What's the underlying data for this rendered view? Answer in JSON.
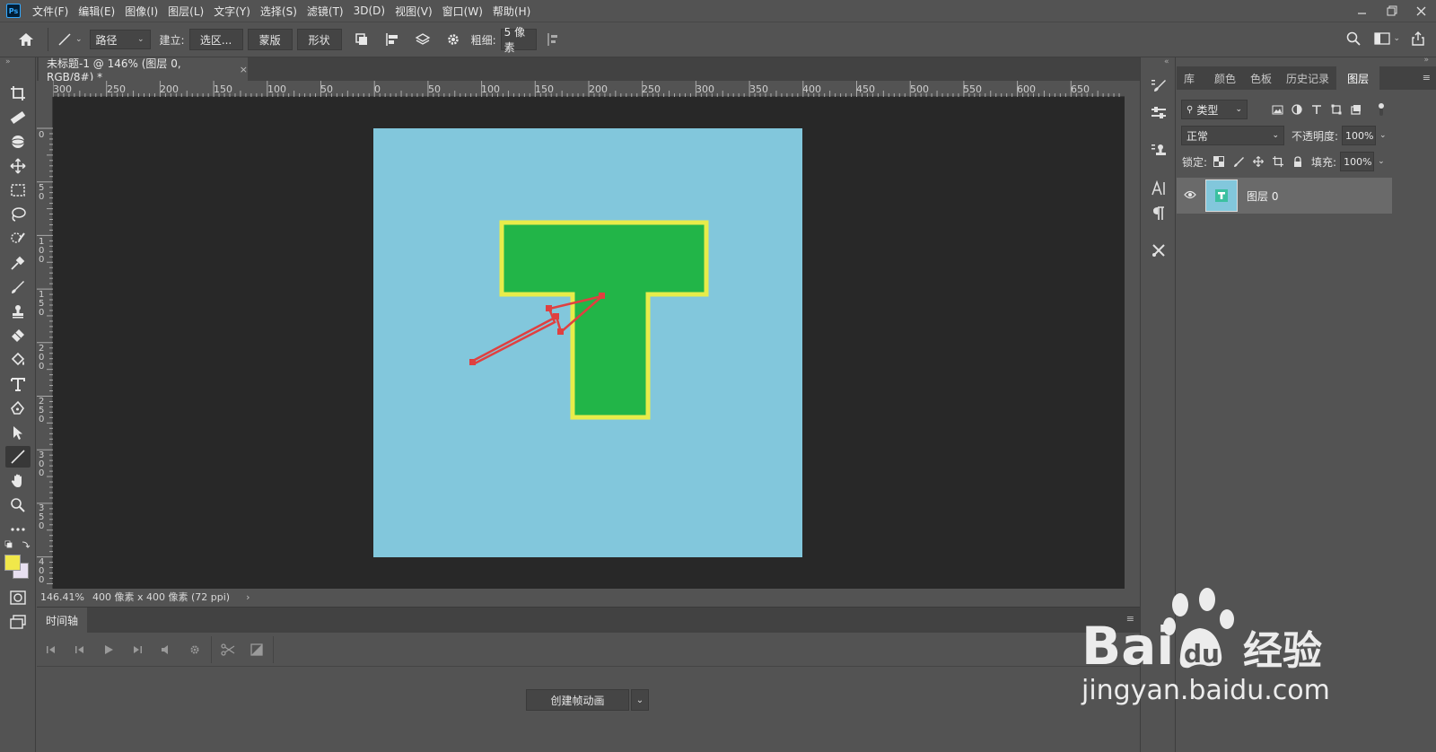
{
  "app": {
    "logo": "Ps",
    "menu": [
      "文件(F)",
      "编辑(E)",
      "图像(I)",
      "图层(L)",
      "文字(Y)",
      "选择(S)",
      "滤镜(T)",
      "3D(D)",
      "视图(V)",
      "窗口(W)",
      "帮助(H)"
    ]
  },
  "options": {
    "mode": "路径",
    "make_label": "建立:",
    "selection_btn": "选区...",
    "mask_btn": "蒙版",
    "shape_btn": "形状",
    "weight_label": "粗细:",
    "weight_value": "5 像素"
  },
  "document": {
    "tab_title": "未标题-1 @ 146% (图层 0, RGB/8#) *",
    "close": "×",
    "zoom": "146.41%",
    "info": "400 像素 x 400 像素 (72 ppi)",
    "canvas_color": "#82c7dc"
  },
  "ruler": {
    "h_labels": [
      "300",
      "250",
      "200",
      "150",
      "100",
      "50",
      "0",
      "50",
      "100",
      "150",
      "200",
      "250",
      "300",
      "350",
      "400",
      "450",
      "500",
      "550",
      "600",
      "650"
    ],
    "v_labels": [
      "0",
      "5 0",
      "1 0 0",
      "1 5 0",
      "2 0 0",
      "2 5 0",
      "3 0 0",
      "3 5 0",
      "4 0 0"
    ]
  },
  "artwork": {
    "t_fill": "#22b548",
    "t_stroke": "#e8ec4a",
    "arrow_color": "#e04040"
  },
  "timeline": {
    "tab": "时间轴",
    "create_btn": "创建帧动画"
  },
  "panels": {
    "tabs": [
      "库",
      "颜色",
      "色板",
      "历史记录",
      "图层"
    ],
    "filter": "类型",
    "blend_mode": "正常",
    "opacity_label": "不透明度:",
    "opacity_value": "100%",
    "lock_label": "锁定:",
    "fill_label": "填充:",
    "fill_value": "100%",
    "layer_name": "图层 0"
  },
  "colors": {
    "foreground": "#f0e84a",
    "background": "#e8e0f0"
  },
  "watermark": {
    "brand": "Bai",
    "brand_du": "du",
    "suffix": "经验",
    "url": "jingyan.baidu.com"
  }
}
